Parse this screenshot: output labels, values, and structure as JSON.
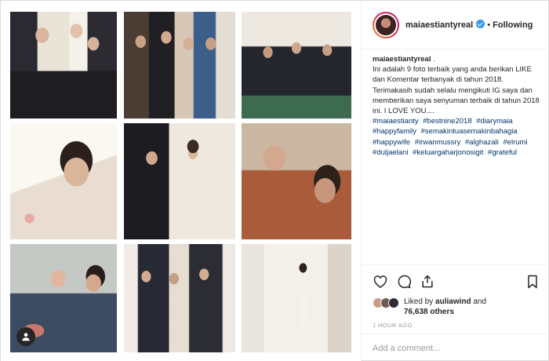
{
  "post": {
    "username": "maiaestiantyreal",
    "verified_icon": "verified-badge-icon",
    "separator": "•",
    "follow_status": "Following",
    "caption_username": "maiaestiantyreal",
    "caption_text": "Ini adalah 9 foto terbaik yang anda berikan LIKE dan Komentar terbanyak di tahun 2018. Terimakasih sudah selalu mengikuti IG saya dan memberikan saya senyuman terbaik di tahun 2018 ini. I LOVE YOU....",
    "hashtags": [
      "#maiaestianty",
      "#bestnine2018",
      "#diarymaia",
      "#happyfamily",
      "#semakintuasemakinbahagia",
      "#happywife",
      "#irwanmussry",
      "#alghazali",
      "#elrumi",
      "#duljaelani",
      "#keluargaharjonosigit",
      "#grateful"
    ],
    "liked_by_prefix": "Liked by",
    "liked_by_user": "auliawind",
    "liked_by_and": "and",
    "likes_count": "76,638 others",
    "time_ago": "1 HOUR AGO",
    "comment_placeholder": "Add a comment..."
  },
  "icons": {
    "like": "heart-icon",
    "comment": "comment-icon",
    "share": "share-icon",
    "save": "bookmark-icon",
    "tagged": "user-tag-icon"
  },
  "colors": {
    "hashtag": "#003569",
    "verified": "#3897f0",
    "muted": "#999999",
    "text": "#262626"
  }
}
